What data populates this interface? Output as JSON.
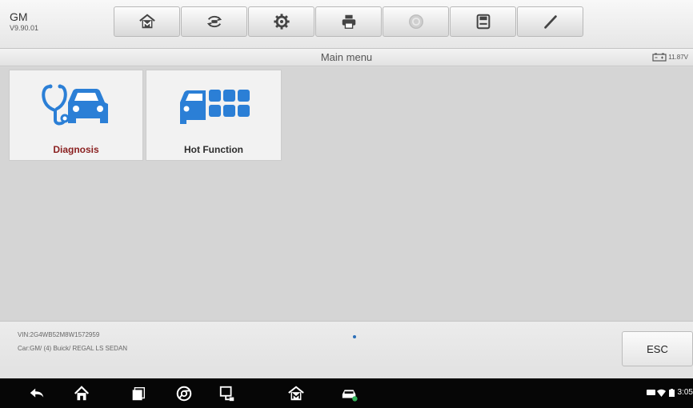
{
  "app": {
    "name": "GM",
    "version": "V9.90.01"
  },
  "toolbar": {
    "buttons": [
      {
        "icon": "home-m-icon"
      },
      {
        "icon": "vehicle-swap-icon"
      },
      {
        "icon": "gear-icon"
      },
      {
        "icon": "printer-icon"
      },
      {
        "icon": "help-icon"
      },
      {
        "icon": "save-icon"
      },
      {
        "icon": "pen-icon"
      }
    ]
  },
  "subheader": {
    "title": "Main menu",
    "battery_voltage": "11.87V"
  },
  "tiles": [
    {
      "label": "Diagnosis",
      "icon": "stethoscope-car-icon"
    },
    {
      "label": "Hot Function",
      "icon": "car-grid-icon"
    }
  ],
  "footer": {
    "vin": "VIN:2G4WB52M8W1572959",
    "car": "Car:GM/ (4) Buick/ REGAL LS SEDAN",
    "esc_label": "ESC"
  },
  "navbar": {
    "buttons": [
      "back-icon",
      "home-icon",
      "recent-apps-icon",
      "chrome-icon",
      "vci-connect-icon",
      "maxisys-home-icon",
      "car-status-icon"
    ],
    "clock": "3:05"
  },
  "colors": {
    "accent_blue": "#2b7fd6",
    "diagnosis_label": "#8a1f1f"
  }
}
